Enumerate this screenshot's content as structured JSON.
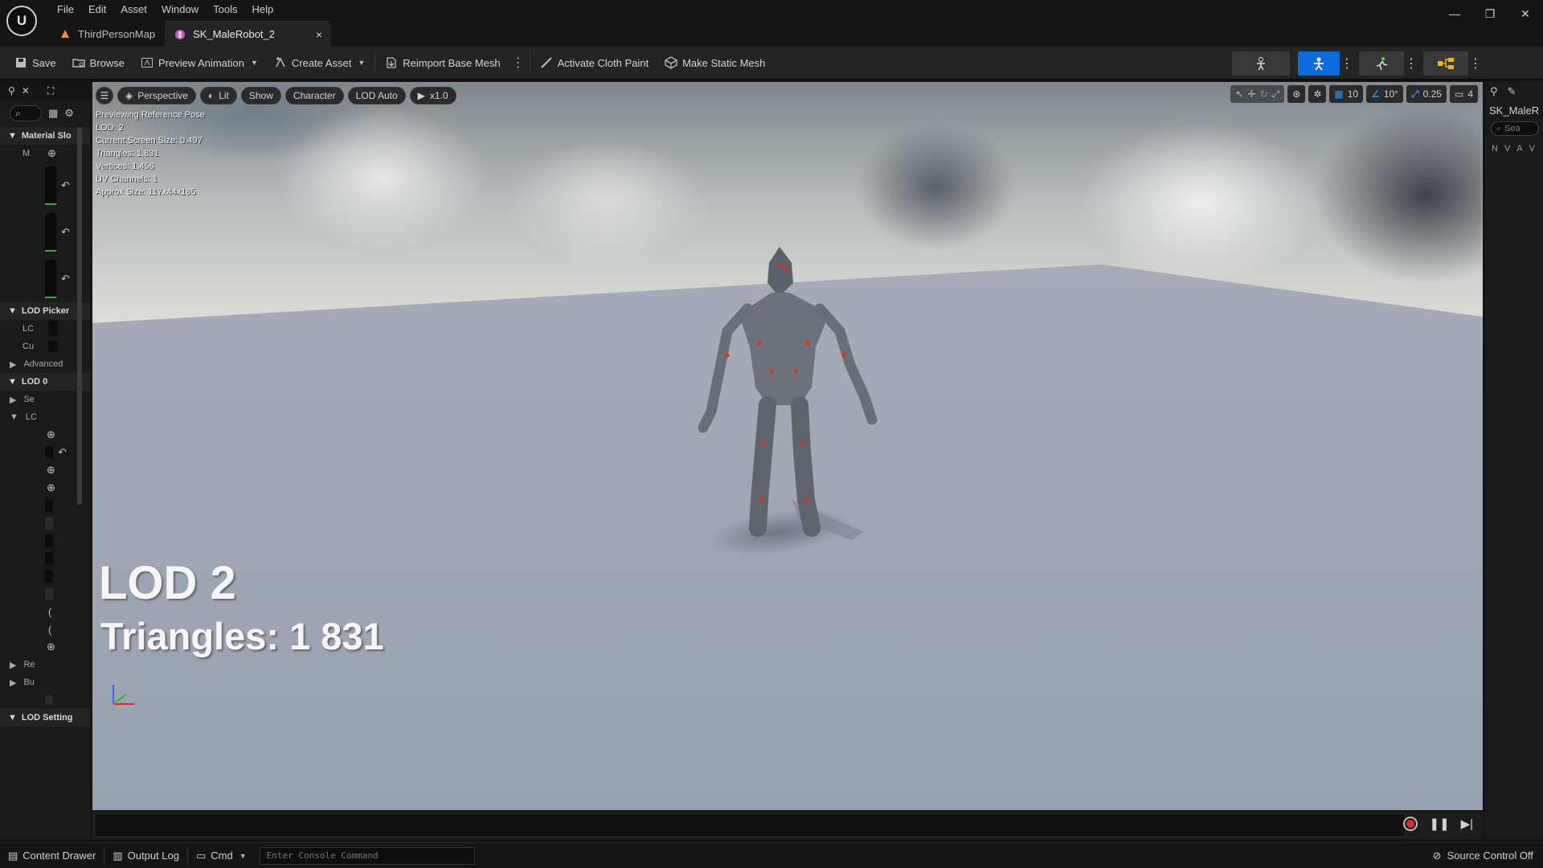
{
  "app": {
    "logo": "U",
    "menu": [
      "File",
      "Edit",
      "Asset",
      "Window",
      "Tools",
      "Help"
    ],
    "window_controls": {
      "minimize": "—",
      "restore": "❐",
      "close": "✕"
    }
  },
  "tabs": [
    {
      "label": "ThirdPersonMap",
      "icon": "map-icon",
      "active": false
    },
    {
      "label": "SK_MaleRobot_2",
      "icon": "skeletal-mesh-icon",
      "active": true,
      "close": "×"
    }
  ],
  "toolbar": {
    "save": "Save",
    "browse": "Browse",
    "preview_animation": "Preview Animation",
    "create_asset": "Create Asset",
    "reimport": "Reimport Base Mesh",
    "cloth_paint": "Activate Cloth Paint",
    "static_mesh": "Make Static Mesh"
  },
  "left_panel": {
    "sections": {
      "material_slots": "Material Slo",
      "lod_picker": "LOD Picker",
      "advanced": "Advanced",
      "lod0": "LOD 0",
      "lod_settings": "LOD Setting"
    },
    "rows": {
      "m": "M",
      "lc1": "LC",
      "cu": "Cu",
      "se": "Se",
      "lc2": "LC",
      "re": "Re",
      "bu": "Bu"
    }
  },
  "viewport": {
    "perspective": "Perspective",
    "lit": "Lit",
    "show": "Show",
    "character": "Character",
    "lod_auto": "LOD Auto",
    "speed": "x1.0",
    "grid_snap": "10",
    "rot_snap": "10°",
    "scale_snap": "0.25",
    "camera_speed": "4",
    "stats": [
      "Previewing Reference Pose",
      "LOD: 2",
      "Current Screen Size: 0.497",
      "Triangles: 1,831",
      "Vertices: 1,456",
      "UV Channels: 1",
      "Approx Size: 117x44x185"
    ],
    "lod_label": "LOD 2",
    "triangles_label": "Triangles: 1 831"
  },
  "right_panel": {
    "title": "SK_MaleR",
    "search_placeholder": "Sea",
    "columns": [
      "N",
      "V",
      "A",
      "V"
    ]
  },
  "statusbar": {
    "content_drawer": "Content Drawer",
    "output_log": "Output Log",
    "cmd": "Cmd",
    "console_placeholder": "Enter Console Command",
    "source_control": "Source Control Off"
  },
  "colors": {
    "accent": "#0b6bdb",
    "panel": "#1a1a1a",
    "toolbar": "#242424",
    "record": "#d03030"
  }
}
